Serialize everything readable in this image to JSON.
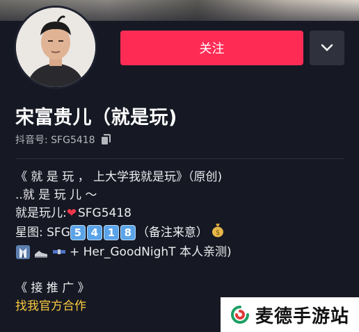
{
  "profile": {
    "follow_label": "关注",
    "display_name": "宋富贵儿（就是玩)",
    "douyin_id": "抖音号: SFG5418"
  },
  "bio": {
    "line1": "《 就 是 玩 ， 上大学我就是玩》（原创)",
    "line2": "..就 是 玩 儿 ～",
    "line3_prefix": "就是玩儿: ",
    "line3_value": "SFG5418",
    "line4_prefix": "星图: SFG",
    "line4_digits": [
      "5",
      "4",
      "1",
      "8"
    ],
    "line4_suffix": "（备注来意）",
    "line5_text": "+ Her_GoodNighT 本人亲测)",
    "line7": "《 接 推 广 》",
    "line8": "找我官方合作"
  },
  "watermark": {
    "text": "麦德手游站"
  },
  "colors": {
    "background": "#161823",
    "follow_button": "#fe2c55",
    "link": "#facc40"
  }
}
